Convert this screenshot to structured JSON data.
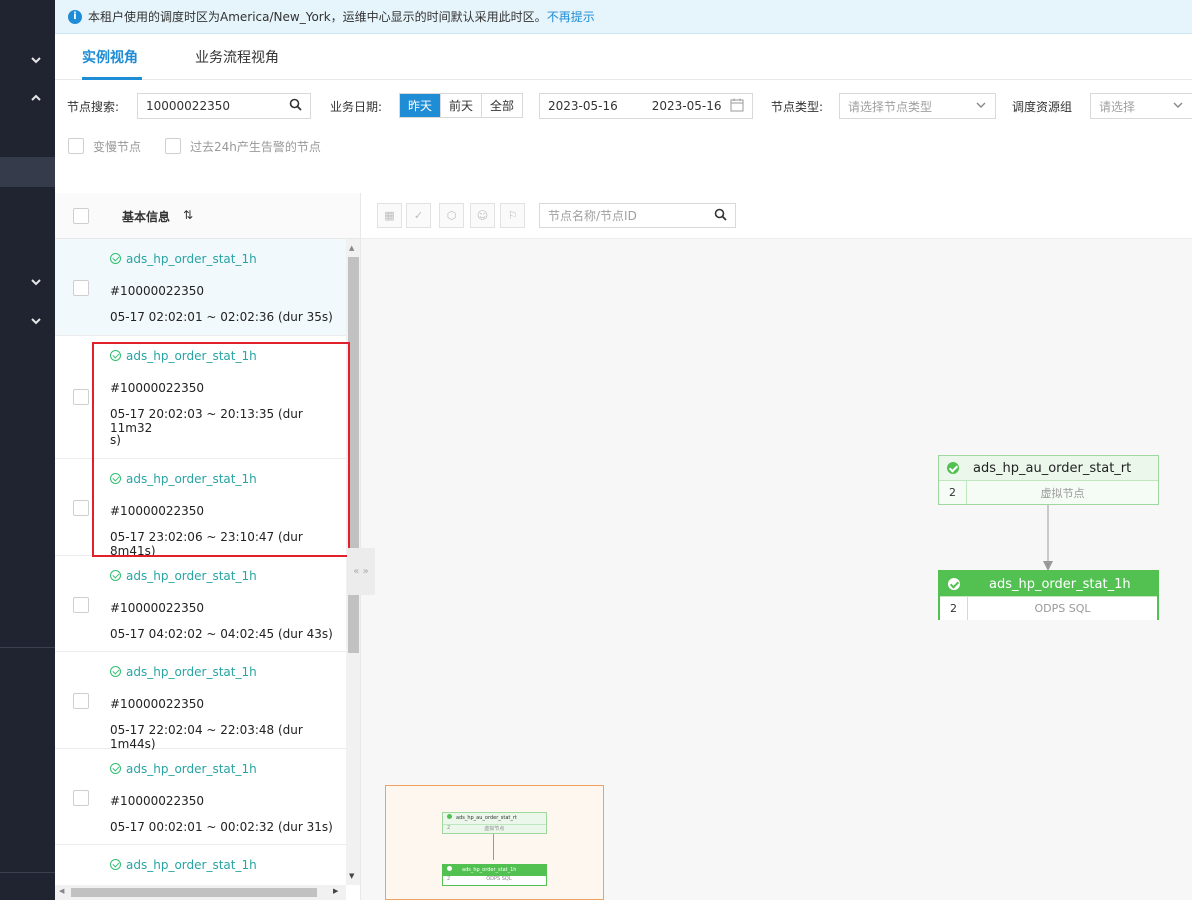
{
  "notice": {
    "text": "本租户使用的调度时区为America/New_York，运维中心显示的时间默认采用此时区。",
    "link": "不再提示"
  },
  "tabs": [
    {
      "label": "实例视角"
    },
    {
      "label": "业务流程视角"
    }
  ],
  "filters": {
    "node_search_label": "节点搜索:",
    "node_search_value": "10000022350",
    "biz_date_label": "业务日期:",
    "date_segments": [
      "昨天",
      "前天",
      "全部"
    ],
    "date_start": "2023-05-16",
    "date_end": "2023-05-16",
    "node_type_label": "节点类型:",
    "node_type_placeholder": "请选择节点类型",
    "resource_group_label": "调度资源组",
    "resource_group_placeholder": "请选择",
    "slow_nodes_label": "变慢节点",
    "alert_nodes_label": "过去24h产生告警的节点"
  },
  "list": {
    "header": "基本信息",
    "rows": [
      {
        "name": "ads_hp_order_stat_1h",
        "id": "#10000022350",
        "time": "05-17 02:02:01 ~ 02:02:36 (dur 35s)"
      },
      {
        "name": "ads_hp_order_stat_1h",
        "id": "#10000022350",
        "time": "05-17 20:02:03 ~ 20:13:35 (dur 11m32",
        "time2": "s)"
      },
      {
        "name": "ads_hp_order_stat_1h",
        "id": "#10000022350",
        "time": "05-17 23:02:06 ~ 23:10:47 (dur 8m41s)"
      },
      {
        "name": "ads_hp_order_stat_1h",
        "id": "#10000022350",
        "time": "05-17 04:02:02 ~ 04:02:45 (dur 43s)"
      },
      {
        "name": "ads_hp_order_stat_1h",
        "id": "#10000022350",
        "time": "05-17 22:02:04 ~ 22:03:48 (dur 1m44s)"
      },
      {
        "name": "ads_hp_order_stat_1h",
        "id": "#10000022350",
        "time": "05-17 00:02:01 ~ 00:02:32 (dur 31s)"
      },
      {
        "name": "ads_hp_order_stat_1h"
      }
    ]
  },
  "canvas": {
    "search_placeholder": "节点名称/节点ID",
    "parent_node": {
      "name": "ads_hp_au_order_stat_rt",
      "count": "2",
      "type": "虚拟节点"
    },
    "main_node": {
      "name": "ads_hp_order_stat_1h",
      "count": "2",
      "type": "ODPS SQL"
    }
  },
  "colors": {
    "accent": "#1f8dd6",
    "success": "#52c152",
    "highlight": "#e0202a"
  }
}
